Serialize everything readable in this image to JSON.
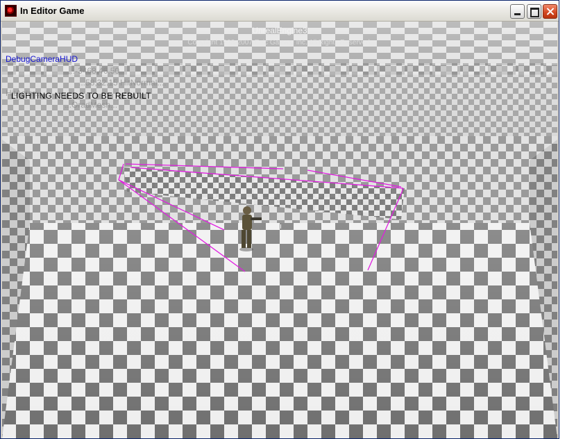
{
  "window": {
    "title": "In Editor Game",
    "buttons": {
      "minimize": "minimize",
      "maximize": "maximize",
      "close": "close"
    }
  },
  "hud": {
    "engine_name": "UnrealEngine3",
    "copyright": "Copyright 1998-2007 Epic Games, Inc. All Rights Reserved.",
    "debug_label": "DebugCameraHUD",
    "ghost_line_1": "...-3468.46,50",
    "ghost_line_2": "...58,32.15 HitNormal:...",
    "ghost_line_3": "HitActor:...",
    "ghost_line_4": "...OradMesh...",
    "warning": "LIGHTING NEEDS TO BE REBUILT"
  },
  "scene": {
    "floor_light": "#f2f2f2",
    "floor_dark": "#6e6e6e",
    "selection_color": "#e01ee0"
  }
}
